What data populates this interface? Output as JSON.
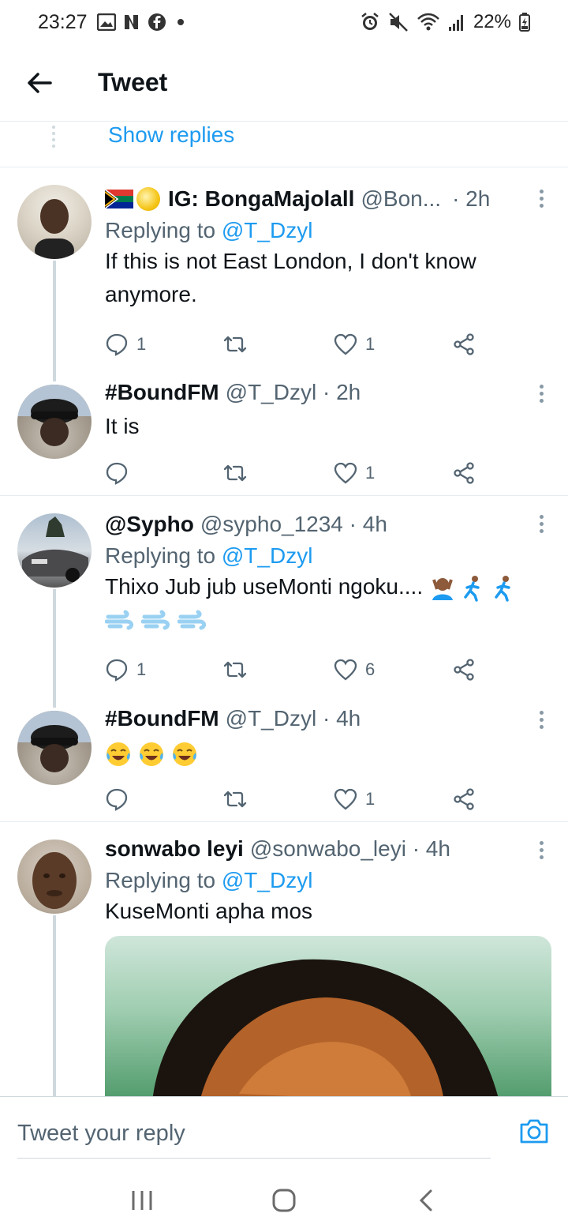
{
  "status_bar": {
    "time": "23:27",
    "battery": "22%"
  },
  "header": {
    "title": "Tweet"
  },
  "show_replies": "Show replies",
  "tweets": [
    {
      "name": "IG: BongaMajolall",
      "handle": "@Bon...",
      "time": " · 2h",
      "replying_prefix": "Replying to ",
      "replying_to": "@T_Dzyl",
      "text": "If this is not East London, I don't know anymore.",
      "reply_count": "1",
      "like_count": "1"
    },
    {
      "name": "#BoundFM",
      "handle": "@T_Dzyl · 2h",
      "text": "It is",
      "like_count": "1"
    },
    {
      "name": "@Sypho",
      "handle": "@sypho_1234 · 4h",
      "replying_prefix": "Replying to ",
      "replying_to": "@T_Dzyl",
      "text": "Thixo Jub jub useMonti ngoku....",
      "reply_count": "1",
      "like_count": "6"
    },
    {
      "name": "#BoundFM",
      "handle": "@T_Dzyl · 4h",
      "like_count": "1"
    },
    {
      "name": "sonwabo leyi",
      "handle": "@sonwabo_leyi · 4h",
      "replying_prefix": "Replying to ",
      "replying_to": "@T_Dzyl",
      "text": "KuseMonti apha mos"
    }
  ],
  "reply_bar": {
    "placeholder": "Tweet your reply"
  },
  "icons": {
    "back": "arrow-left-icon",
    "reply": "chat-bubble-icon",
    "retweet": "retweet-icon",
    "like": "heart-icon",
    "share": "share-icon",
    "camera": "camera-icon"
  },
  "colors": {
    "link": "#1d9bf0",
    "secondary_text": "#536471",
    "divider": "#e6ecf0"
  }
}
